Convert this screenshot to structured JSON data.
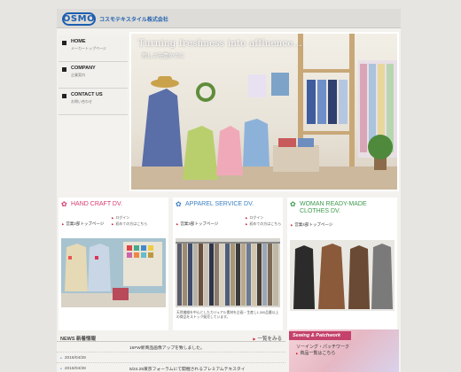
{
  "header": {
    "logo_mark": "OSMO",
    "logo_text": "コスモテキスタイル株式会社"
  },
  "nav": [
    {
      "title": "HOME",
      "sub": "メーカートップページ"
    },
    {
      "title": "COMPANY",
      "sub": "企業案内"
    },
    {
      "title": "CONTACT US",
      "sub": "お問い合わせ"
    }
  ],
  "hero": {
    "title": "Turning freshness into affluence…",
    "subtitle": "新しさを豊かさに"
  },
  "columns": [
    {
      "title": "HAND CRAFT DV.",
      "color": "#d63a6e",
      "main_link": "営業2部トップページ",
      "small_links": [
        "ログイン",
        "初めての方はこちら"
      ],
      "text": ""
    },
    {
      "title": "APPAREL SERVICE DV.",
      "color": "#3b7fc4",
      "main_link": "営業3部トップページ",
      "small_links": [
        "ログイン",
        "初めての方はこちら"
      ],
      "text": "天然繊維を中心としたカジュアル素材を企画・生産し1,300品番以上の商品をストック販売しています。"
    },
    {
      "title": "WOMAN READY-MADE CLOTHES DV.",
      "color": "#3e9a4d",
      "main_link": "営業4部トップページ",
      "small_links": [],
      "text": ""
    }
  ],
  "news": {
    "title": "NEWS 新着情報",
    "more": "一覧をみる",
    "items": [
      {
        "date": "",
        "text": "16FW新商品画像アップを致しました。"
      },
      {
        "date": "2016/04/28",
        "text": ""
      },
      {
        "date": "2016/04/28",
        "text": "5/24.25東京フォーラムにて開催されるプレミアムテキスタイ"
      }
    ]
  },
  "banner": {
    "title": "Sewing & Patchwork",
    "line1": "ソーイング・パッチワーク",
    "line2": "商品一覧はこちら"
  }
}
